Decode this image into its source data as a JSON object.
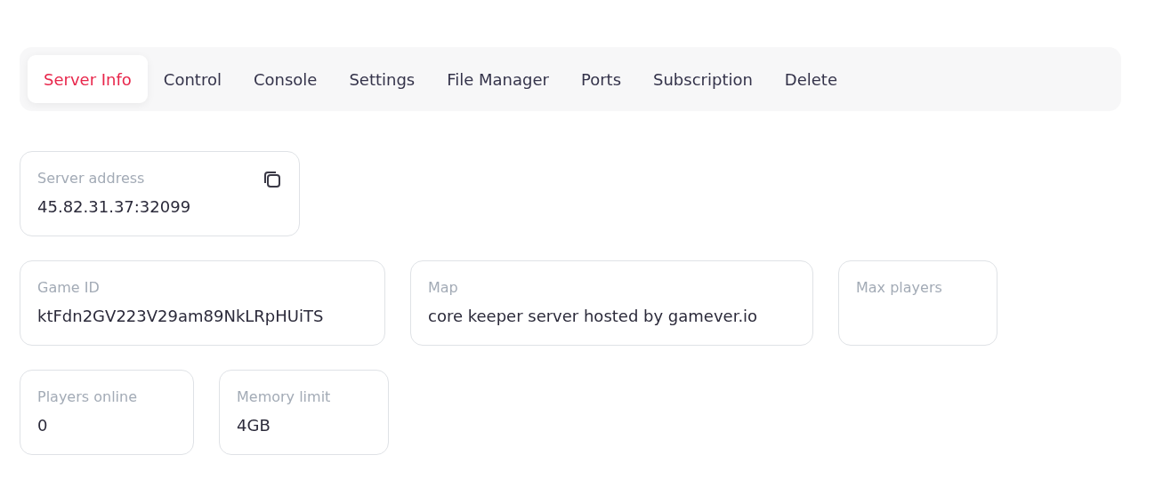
{
  "tabs": [
    {
      "label": "Server Info",
      "selected": true
    },
    {
      "label": "Control",
      "selected": false
    },
    {
      "label": "Console",
      "selected": false
    },
    {
      "label": "Settings",
      "selected": false
    },
    {
      "label": "File Manager",
      "selected": false
    },
    {
      "label": "Ports",
      "selected": false
    },
    {
      "label": "Subscription",
      "selected": false
    },
    {
      "label": "Delete",
      "selected": false
    }
  ],
  "info_rows": [
    {
      "cards": [
        {
          "label": "Server address",
          "value": "45.82.31.37:32099",
          "copy_button": true
        }
      ]
    },
    {
      "cards": [
        {
          "label": "Game ID",
          "value": "ktFdn2GV223V29am89NkLRpHUiTS"
        },
        {
          "label": "Map",
          "value": "core keeper server hosted by gamever.io"
        },
        {
          "label": "Max players"
        }
      ]
    },
    {
      "cards": [
        {
          "label": "Players online",
          "value": "0"
        },
        {
          "label": "Memory limit",
          "value": "4GB"
        }
      ]
    }
  ]
}
